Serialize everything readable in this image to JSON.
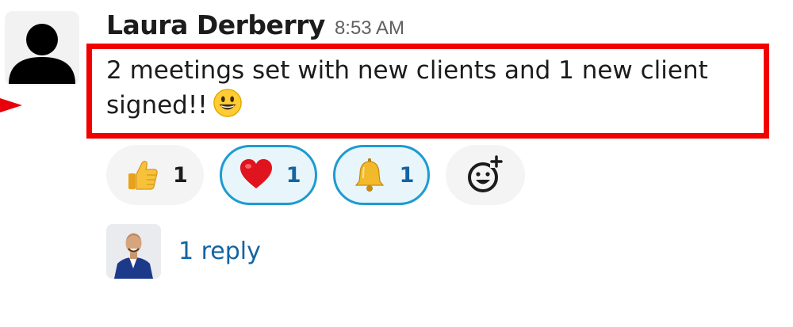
{
  "message": {
    "author": "Laura Derberry",
    "time": "8:53 AM",
    "text": "2 meetings set with new clients and 1 new client signed!!",
    "inline_emoji": "grinning-face-emoji"
  },
  "reactions": [
    {
      "emoji": "thumbs-up-emoji",
      "count": "1",
      "active": false
    },
    {
      "emoji": "red-heart-emoji",
      "count": "1",
      "active": true
    },
    {
      "emoji": "bell-emoji",
      "count": "1",
      "active": true
    }
  ],
  "add_reaction_icon": "add-reaction-icon",
  "thread": {
    "reply_label": "1 reply",
    "replier_avatar": "replier-avatar-photo"
  },
  "colors": {
    "highlight_border": "#f20000",
    "active_reaction_border": "#1d9bd1",
    "active_reaction_bg": "#e8f5fa",
    "link": "#1264a3",
    "timestamp": "#616061"
  }
}
